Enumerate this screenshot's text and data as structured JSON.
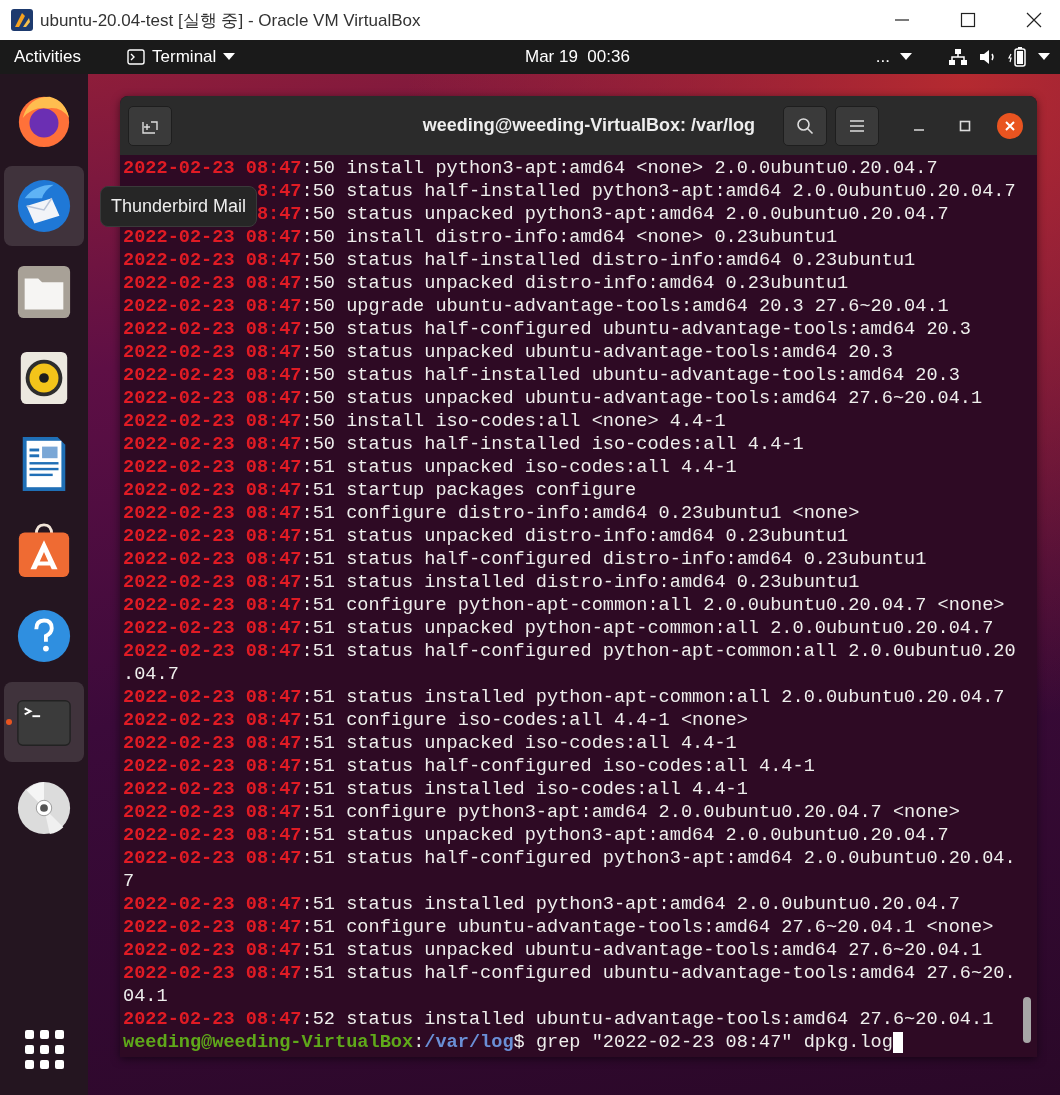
{
  "vm_window": {
    "title": "ubuntu-20.04-test [실행 중] - Oracle VM VirtualBox"
  },
  "top_bar": {
    "activities": "Activities",
    "app_menu": "Terminal",
    "clock": "Mar 19  00:36",
    "overflow": "..."
  },
  "dock": {
    "items": [
      {
        "kind": "firefox",
        "highlighted": false,
        "running": false
      },
      {
        "kind": "thunderbird",
        "highlighted": true,
        "running": false
      },
      {
        "kind": "files",
        "highlighted": false,
        "running": false
      },
      {
        "kind": "rhythmbox",
        "highlighted": false,
        "running": false
      },
      {
        "kind": "writer",
        "highlighted": false,
        "running": false
      },
      {
        "kind": "software",
        "highlighted": false,
        "running": false
      },
      {
        "kind": "help",
        "highlighted": false,
        "running": false
      },
      {
        "kind": "terminal",
        "highlighted": true,
        "running": true
      },
      {
        "kind": "disc",
        "highlighted": false,
        "running": false
      }
    ],
    "tooltip": "Thunderbird Mail"
  },
  "terminal": {
    "title": "weeding@weeding-VirtualBox: /var/log",
    "lines": [
      {
        "kind": "match",
        "match": "2022-02-23 08:47",
        "text": ":50 install python3-apt:amd64 <none> 2.0.0ubuntu0.20.04.7"
      },
      {
        "kind": "covered",
        "match": "8:47",
        "text": ":50 status half-installed python3-apt:amd64 2.0.0ubuntu0.20.04.7"
      },
      {
        "kind": "covered",
        "match": "8:47",
        "text": ":50 status unpacked python3-apt:amd64 2.0.0ubuntu0.20.04.7"
      },
      {
        "kind": "match",
        "match": "2022-02-23 08:47",
        "text": ":50 install distro-info:amd64 <none> 0.23ubuntu1"
      },
      {
        "kind": "match",
        "match": "2022-02-23 08:47",
        "text": ":50 status half-installed distro-info:amd64 0.23ubuntu1"
      },
      {
        "kind": "match",
        "match": "2022-02-23 08:47",
        "text": ":50 status unpacked distro-info:amd64 0.23ubuntu1"
      },
      {
        "kind": "match",
        "match": "2022-02-23 08:47",
        "text": ":50 upgrade ubuntu-advantage-tools:amd64 20.3 27.6~20.04.1"
      },
      {
        "kind": "match",
        "match": "2022-02-23 08:47",
        "text": ":50 status half-configured ubuntu-advantage-tools:amd64 20.3"
      },
      {
        "kind": "match",
        "match": "2022-02-23 08:47",
        "text": ":50 status unpacked ubuntu-advantage-tools:amd64 20.3"
      },
      {
        "kind": "match",
        "match": "2022-02-23 08:47",
        "text": ":50 status half-installed ubuntu-advantage-tools:amd64 20.3"
      },
      {
        "kind": "match",
        "match": "2022-02-23 08:47",
        "text": ":50 status unpacked ubuntu-advantage-tools:amd64 27.6~20.04.1"
      },
      {
        "kind": "match",
        "match": "2022-02-23 08:47",
        "text": ":50 install iso-codes:all <none> 4.4-1"
      },
      {
        "kind": "match",
        "match": "2022-02-23 08:47",
        "text": ":50 status half-installed iso-codes:all 4.4-1"
      },
      {
        "kind": "match",
        "match": "2022-02-23 08:47",
        "text": ":51 status unpacked iso-codes:all 4.4-1"
      },
      {
        "kind": "match",
        "match": "2022-02-23 08:47",
        "text": ":51 startup packages configure"
      },
      {
        "kind": "match",
        "match": "2022-02-23 08:47",
        "text": ":51 configure distro-info:amd64 0.23ubuntu1 <none>"
      },
      {
        "kind": "match",
        "match": "2022-02-23 08:47",
        "text": ":51 status unpacked distro-info:amd64 0.23ubuntu1"
      },
      {
        "kind": "match",
        "match": "2022-02-23 08:47",
        "text": ":51 status half-configured distro-info:amd64 0.23ubuntu1"
      },
      {
        "kind": "match",
        "match": "2022-02-23 08:47",
        "text": ":51 status installed distro-info:amd64 0.23ubuntu1"
      },
      {
        "kind": "match",
        "match": "2022-02-23 08:47",
        "text": ":51 configure python-apt-common:all 2.0.0ubuntu0.20.04.7 <none>"
      },
      {
        "kind": "match",
        "match": "2022-02-23 08:47",
        "text": ":51 status unpacked python-apt-common:all 2.0.0ubuntu0.20.04.7"
      },
      {
        "kind": "match",
        "match": "2022-02-23 08:47",
        "text": ":51 status half-configured python-apt-common:all 2.0.0ubuntu0.20"
      },
      {
        "kind": "wrap",
        "text": ".04.7"
      },
      {
        "kind": "match",
        "match": "2022-02-23 08:47",
        "text": ":51 status installed python-apt-common:all 2.0.0ubuntu0.20.04.7"
      },
      {
        "kind": "match",
        "match": "2022-02-23 08:47",
        "text": ":51 configure iso-codes:all 4.4-1 <none>"
      },
      {
        "kind": "match",
        "match": "2022-02-23 08:47",
        "text": ":51 status unpacked iso-codes:all 4.4-1"
      },
      {
        "kind": "match",
        "match": "2022-02-23 08:47",
        "text": ":51 status half-configured iso-codes:all 4.4-1"
      },
      {
        "kind": "match",
        "match": "2022-02-23 08:47",
        "text": ":51 status installed iso-codes:all 4.4-1"
      },
      {
        "kind": "match",
        "match": "2022-02-23 08:47",
        "text": ":51 configure python3-apt:amd64 2.0.0ubuntu0.20.04.7 <none>"
      },
      {
        "kind": "match",
        "match": "2022-02-23 08:47",
        "text": ":51 status unpacked python3-apt:amd64 2.0.0ubuntu0.20.04.7"
      },
      {
        "kind": "match",
        "match": "2022-02-23 08:47",
        "text": ":51 status half-configured python3-apt:amd64 2.0.0ubuntu0.20.04."
      },
      {
        "kind": "wrap",
        "text": "7"
      },
      {
        "kind": "match",
        "match": "2022-02-23 08:47",
        "text": ":51 status installed python3-apt:amd64 2.0.0ubuntu0.20.04.7"
      },
      {
        "kind": "match",
        "match": "2022-02-23 08:47",
        "text": ":51 configure ubuntu-advantage-tools:amd64 27.6~20.04.1 <none>"
      },
      {
        "kind": "match",
        "match": "2022-02-23 08:47",
        "text": ":51 status unpacked ubuntu-advantage-tools:amd64 27.6~20.04.1"
      },
      {
        "kind": "match",
        "match": "2022-02-23 08:47",
        "text": ":51 status half-configured ubuntu-advantage-tools:amd64 27.6~20."
      },
      {
        "kind": "wrap",
        "text": "04.1"
      },
      {
        "kind": "match",
        "match": "2022-02-23 08:47",
        "text": ":52 status installed ubuntu-advantage-tools:amd64 27.6~20.04.1"
      }
    ],
    "prompt": {
      "user_host": "weeding@weeding-VirtualBox",
      "separator": ":",
      "path": "/var/log",
      "symbol": "$",
      "command": "grep \"2022-02-23 08:47\" dpkg.log"
    }
  }
}
